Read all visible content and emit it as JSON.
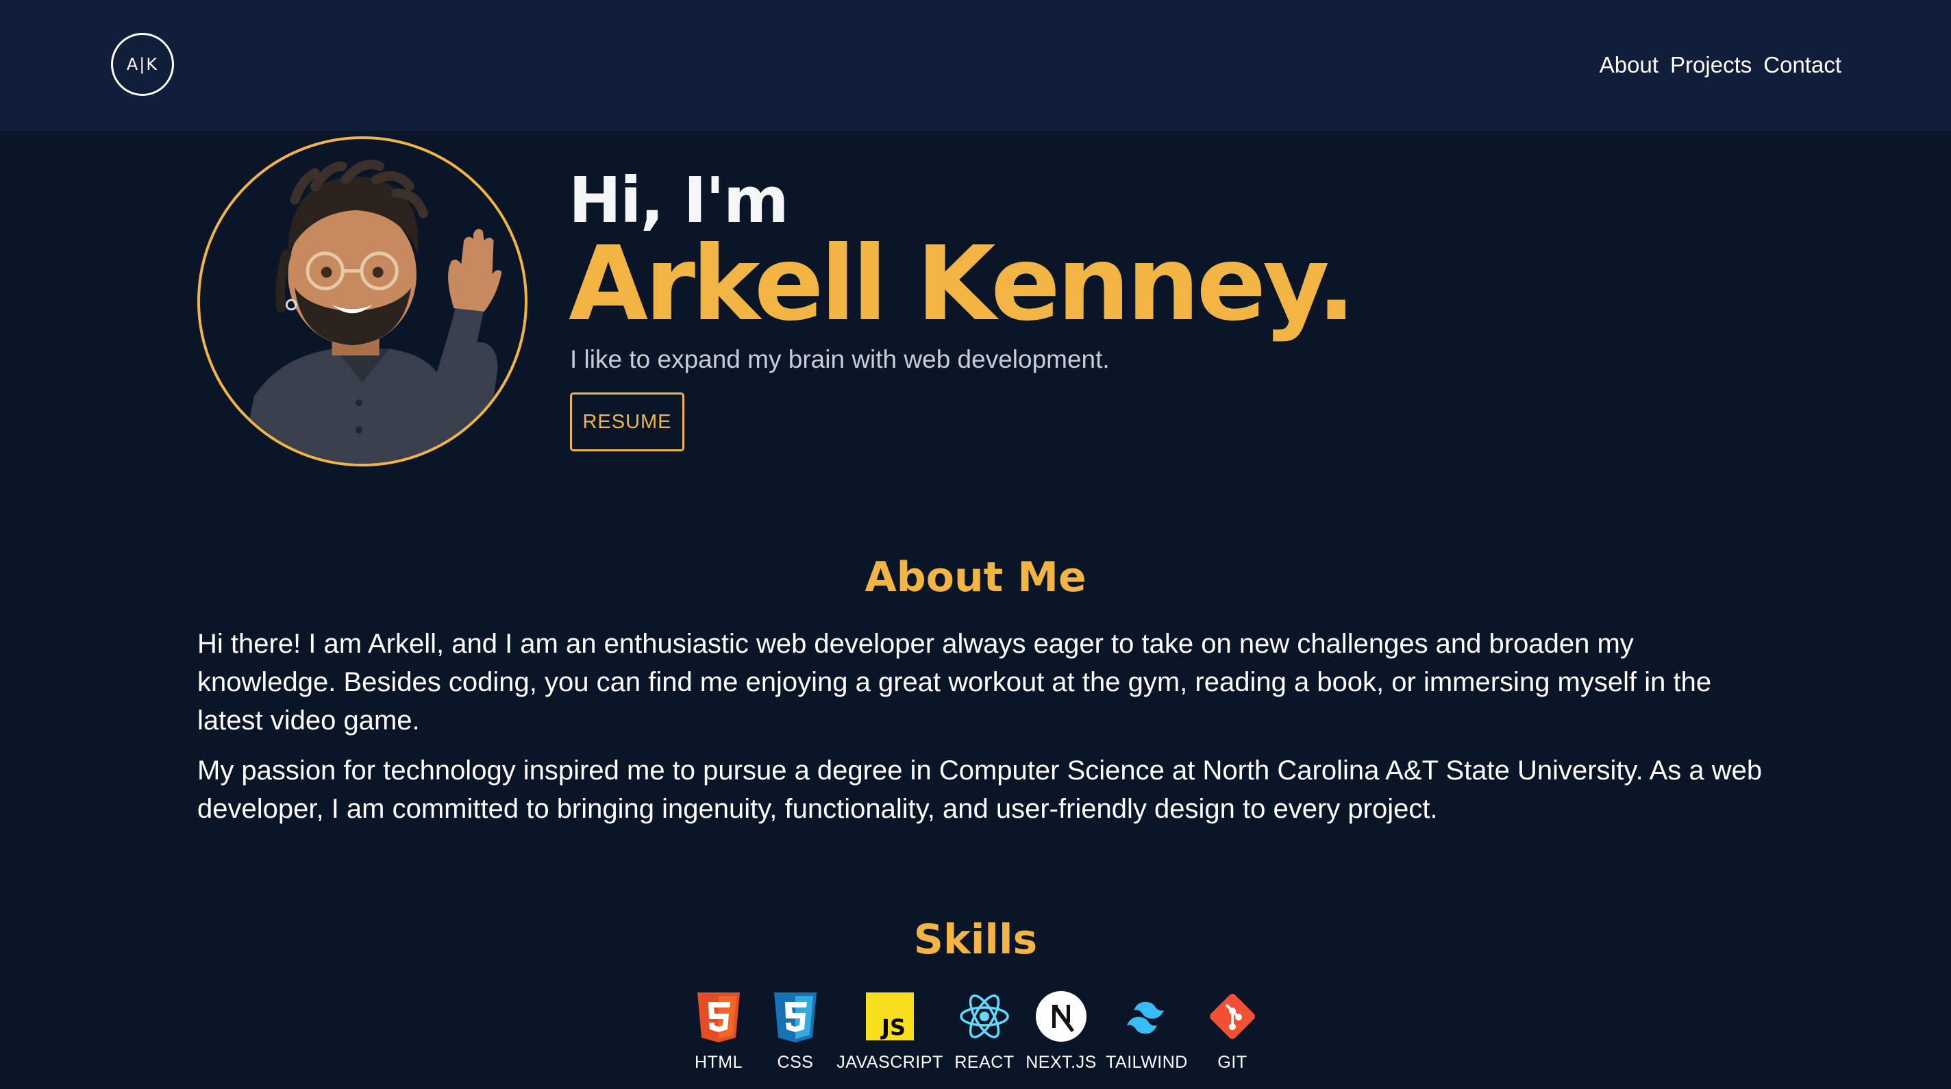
{
  "header": {
    "logo_text": "A|K",
    "nav": [
      {
        "label": "About"
      },
      {
        "label": "Projects"
      },
      {
        "label": "Contact"
      }
    ]
  },
  "hero": {
    "greeting": "Hi, I'm",
    "name": "Arkell Kenney.",
    "tagline": "I like to expand my brain with web development.",
    "resume_label": "RESUME",
    "avatar_icon": "memoji-waving-avatar"
  },
  "about": {
    "title": "About Me",
    "paragraphs": [
      "Hi there! I am Arkell, and I am an enthusiastic web developer always eager to take on new challenges and broaden my knowledge. Besides coding, you can find me enjoying a great workout at the gym, reading a book, or immersing myself in the latest video game.",
      "My passion for technology inspired me to pursue a degree in Computer Science at North Carolina A&T State University. As a web developer, I am committed to bringing ingenuity, functionality, and user-friendly design to every project."
    ]
  },
  "skills": {
    "title": "Skills",
    "items": [
      {
        "label": "HTML",
        "icon": "html5-icon"
      },
      {
        "label": "CSS",
        "icon": "css3-icon"
      },
      {
        "label": "JAVASCRIPT",
        "icon": "javascript-icon"
      },
      {
        "label": "REACT",
        "icon": "react-icon"
      },
      {
        "label": "NEXT.JS",
        "icon": "nextjs-icon"
      },
      {
        "label": "TAILWIND",
        "icon": "tailwind-icon"
      },
      {
        "label": "GIT",
        "icon": "git-icon"
      }
    ]
  },
  "colors": {
    "background": "#0b1528",
    "header": "#101e39",
    "accent": "#f2b544",
    "text": "#ffffff"
  }
}
